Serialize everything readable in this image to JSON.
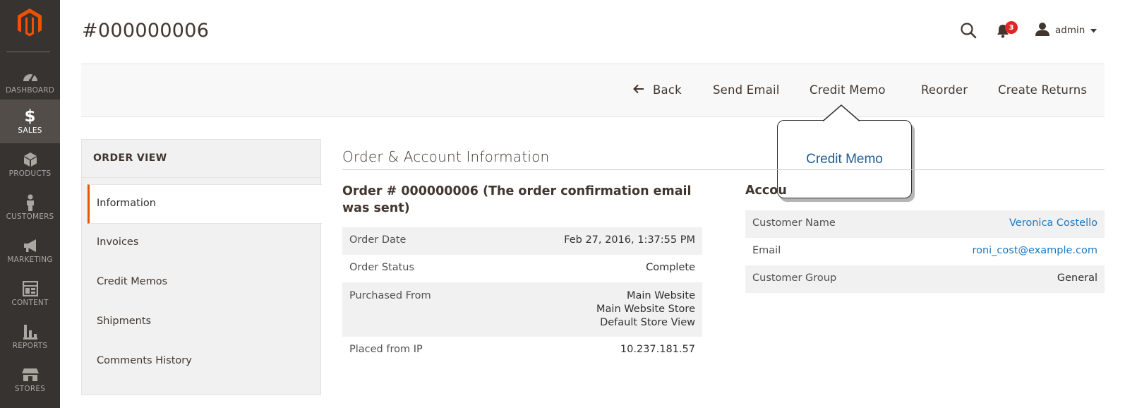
{
  "colors": {
    "sidebar_bg": "#373330",
    "accent": "#eb5202",
    "link": "#1979c3",
    "badge": "#e22626"
  },
  "sidebar": {
    "items": [
      {
        "label": "DASHBOARD",
        "icon": "dashboard-gauge-icon"
      },
      {
        "label": "SALES",
        "icon": "dollar-icon",
        "active": true
      },
      {
        "label": "PRODUCTS",
        "icon": "box-icon"
      },
      {
        "label": "CUSTOMERS",
        "icon": "person-icon"
      },
      {
        "label": "MARKETING",
        "icon": "megaphone-icon"
      },
      {
        "label": "CONTENT",
        "icon": "layout-icon"
      },
      {
        "label": "REPORTS",
        "icon": "bar-chart-icon"
      },
      {
        "label": "STORES",
        "icon": "storefront-icon"
      }
    ]
  },
  "header": {
    "title": "#000000006",
    "notifications_count": "3",
    "user": "admin"
  },
  "actions": {
    "back": "Back",
    "send_email": "Send Email",
    "credit_memo": "Credit Memo",
    "reorder": "Reorder",
    "create_returns": "Create Returns"
  },
  "tooltip": {
    "text": "Credit Memo"
  },
  "order_view": {
    "title": "ORDER VIEW",
    "tabs": [
      "Information",
      "Invoices",
      "Credit Memos",
      "Shipments",
      "Comments History"
    ]
  },
  "section": {
    "title": "Order & Account Information"
  },
  "order": {
    "heading": "Order # 000000006 (The order confirmation email was sent)",
    "rows": [
      {
        "label": "Order Date",
        "value": "Feb 27, 2016, 1:37:55 PM"
      },
      {
        "label": "Order Status",
        "value": "Complete"
      },
      {
        "label": "Purchased From",
        "value_lines": [
          "Main Website",
          "Main Website Store",
          "Default Store View"
        ]
      },
      {
        "label": "Placed from IP",
        "value": "10.237.181.57"
      }
    ]
  },
  "account": {
    "heading": "Accou",
    "rows": [
      {
        "label": "Customer Name",
        "value": "Veronica Costello"
      },
      {
        "label": "Email",
        "value": "roni_cost@example.com"
      },
      {
        "label": "Customer Group",
        "value": "General"
      }
    ]
  }
}
